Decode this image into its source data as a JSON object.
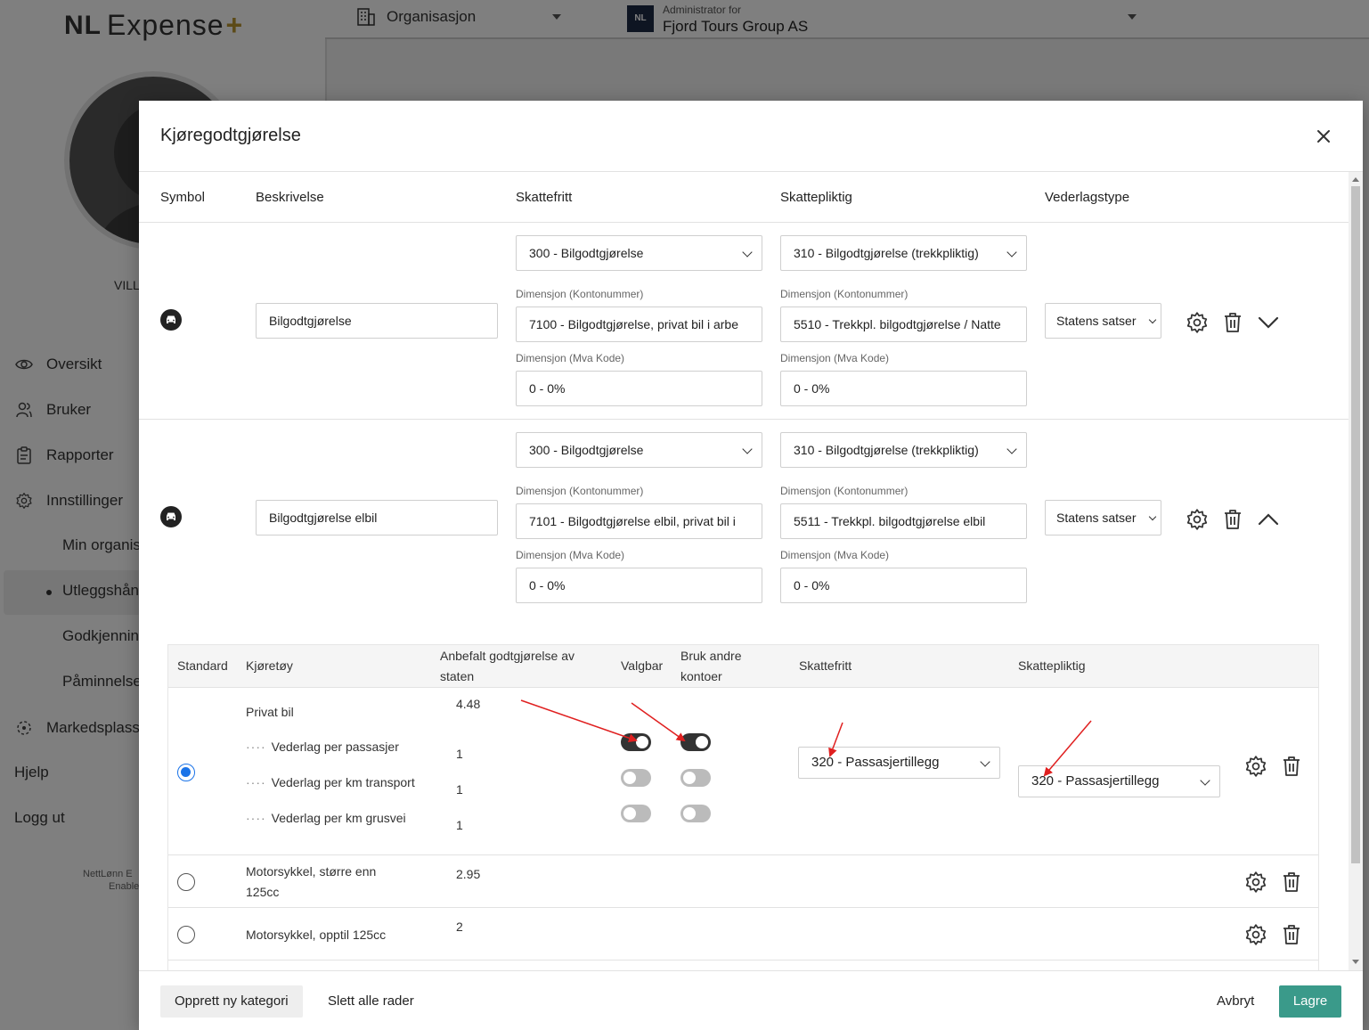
{
  "app": {
    "logo_text": "Expense",
    "logo_prefix": "NL",
    "logo_plus": "+",
    "user_name": "VILL",
    "nav": {
      "overview": "Oversikt",
      "users": "Bruker",
      "reports": "Rapporter",
      "settings": "Innstillinger",
      "my_org": "Min organis",
      "expense": "Utleggshån",
      "approval": "Godkjennin",
      "reminders": "Påminnelse",
      "marketplace": "Markedsplass",
      "help": "Hjelp",
      "logout": "Logg ut"
    },
    "footer_line1": "NettLønn E",
    "footer_line2": "Enable",
    "topbar": {
      "org_label": "Organisasjon",
      "admin_for": "Administrator for",
      "company": "Fjord Tours Group AS",
      "company_logo": "NL"
    }
  },
  "modal": {
    "title": "Kjøregodtgjørelse",
    "columns": {
      "symbol": "Symbol",
      "description": "Beskrivelse",
      "tax_free": "Skattefritt",
      "taxable": "Skattepliktig",
      "compensation_type": "Vederlagstype"
    },
    "labels": {
      "dim_account": "Dimensjon (Kontonummer)",
      "dim_vat": "Dimensjon (Mva Kode)"
    },
    "rows": [
      {
        "description": "Bilgodtgjørelse",
        "tax_free": "300 - Bilgodtgjørelse",
        "taxable": "310 - Bilgodtgjørelse (trekkpliktig)",
        "tax_free_account": "7100 - Bilgodtgjørelse, privat bil i arbe",
        "taxable_account": "5510 - Trekkpl. bilgodtgjørelse / Natte",
        "tax_free_vat": "0 - 0%",
        "taxable_vat": "0 - 0%",
        "compensation_type": "Statens satser",
        "expanded": false
      },
      {
        "description": "Bilgodtgjørelse elbil",
        "tax_free": "300 - Bilgodtgjørelse",
        "taxable": "310 - Bilgodtgjørelse (trekkpliktig)",
        "tax_free_account": "7101 - Bilgodtgjørelse elbil, privat bil i",
        "taxable_account": "5511 - Trekkpl. bilgodtgjørelse elbil",
        "tax_free_vat": "0 - 0%",
        "taxable_vat": "0 - 0%",
        "compensation_type": "Statens satser",
        "expanded": true
      }
    ],
    "sub_table": {
      "headers": {
        "standard": "Standard",
        "vehicle": "Kjøretøy",
        "recommended_line1": "Anbefalt godtgjørelse av",
        "recommended_line2": "staten",
        "selectable": "Valgbar",
        "other_accounts_line1": "Bruk andre",
        "other_accounts_line2": "kontoer",
        "tax_free": "Skattefritt",
        "taxable": "Skattepliktig"
      },
      "private_car": {
        "name": "Privat bil",
        "rate": "4.48",
        "selected": true,
        "extras": [
          {
            "dots": "····",
            "name": "Vederlag per passasjer",
            "rate": "1",
            "selectable": true,
            "other_accounts": true
          },
          {
            "dots": "····",
            "name": "Vederlag per km transport",
            "rate": "1",
            "selectable": false,
            "other_accounts": false
          },
          {
            "dots": "····",
            "name": "Vederlag per km grusvei",
            "rate": "1",
            "selectable": false,
            "other_accounts": false
          }
        ],
        "tax_free_select": "320 - Passasjertillegg",
        "taxable_select": "320 - Passasjertillegg"
      },
      "motorcycle_large": {
        "name_line1": "Motorsykkel, større enn",
        "name_line2": "125cc",
        "rate": "2.95",
        "selected": false
      },
      "motorcycle_small": {
        "name": "Motorsykkel, opptil 125cc",
        "rate": "2",
        "selected": false
      }
    },
    "footer": {
      "create": "Opprett ny kategori",
      "delete_all": "Slett alle rader",
      "cancel": "Avbryt",
      "save": "Lagre"
    }
  },
  "colors": {
    "primary_button": "#3a9a8a",
    "radio_selected": "#1a73e8",
    "annotation_arrow": "#e02020",
    "logo_plus": "#b8942f"
  }
}
